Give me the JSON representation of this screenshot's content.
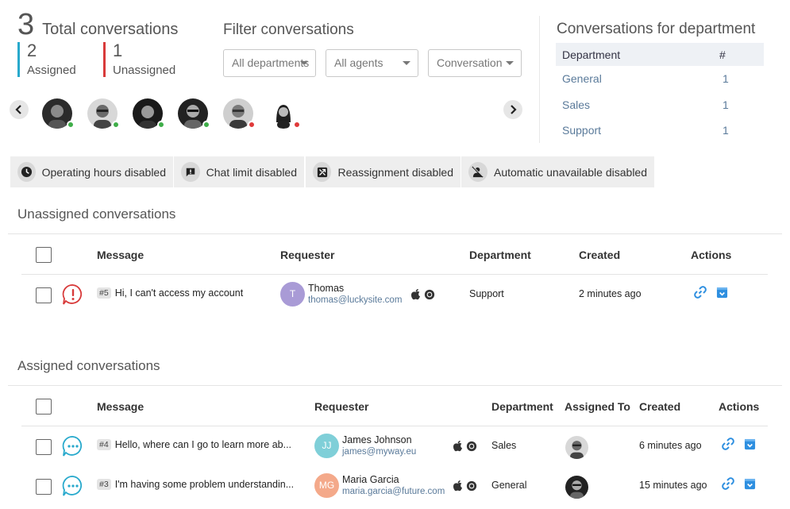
{
  "stats": {
    "total_num": "3",
    "total_label": "Total conversations",
    "assigned_num": "2",
    "assigned_label": "Assigned",
    "unassigned_num": "1",
    "unassigned_label": "Unassigned"
  },
  "filter": {
    "title": "Filter conversations",
    "department": "All departments",
    "agents": "All agents",
    "conversation": "Conversation"
  },
  "dept_panel": {
    "title": "Conversations for department",
    "col_department": "Department",
    "col_count": "#",
    "rows": [
      {
        "name": "General",
        "count": "1"
      },
      {
        "name": "Sales",
        "count": "1"
      },
      {
        "name": "Support",
        "count": "1"
      }
    ]
  },
  "agents": {
    "prev_icon": "chevron-left-icon",
    "next_icon": "chevron-right-icon",
    "list": [
      {
        "status": "online"
      },
      {
        "status": "online"
      },
      {
        "status": "online"
      },
      {
        "status": "online"
      },
      {
        "status": "offline"
      },
      {
        "status": "offline"
      }
    ]
  },
  "features": {
    "operating_hours": "Operating hours disabled",
    "chat_limit": "Chat limit disabled",
    "reassignment": "Reassignment disabled",
    "auto_unavailable": "Automatic unavailable disabled"
  },
  "unassigned": {
    "title": "Unassigned conversations",
    "headers": {
      "message": "Message",
      "requester": "Requester",
      "department": "Department",
      "created": "Created",
      "actions": "Actions"
    },
    "rows": [
      {
        "id": "#5",
        "message": "Hi, I can't access my account",
        "initial": "T",
        "name": "Thomas",
        "email": "thomas@luckysite.com",
        "department": "Support",
        "created": "2 minutes ago"
      }
    ]
  },
  "assigned": {
    "title": "Assigned conversations",
    "headers": {
      "message": "Message",
      "requester": "Requester",
      "department": "Department",
      "assigned_to": "Assigned To",
      "created": "Created",
      "actions": "Actions"
    },
    "rows": [
      {
        "id": "#4",
        "message": "Hello, where can I go to learn more ab...",
        "initial": "JJ",
        "name": "James Johnson",
        "email": "james@myway.eu",
        "department": "Sales",
        "created": "6 minutes ago"
      },
      {
        "id": "#3",
        "message": "I'm having some problem understandin...",
        "initial": "MG",
        "name": "Maria Garcia",
        "email": "maria.garcia@future.com",
        "department": "General",
        "created": "15 minutes ago"
      }
    ]
  },
  "colors": {
    "assigned_accent": "#28a9cc",
    "unassigned_accent": "#d83a3a",
    "online": "#3fae49",
    "offline": "#e03a3a",
    "link": "#2e8fe0"
  }
}
